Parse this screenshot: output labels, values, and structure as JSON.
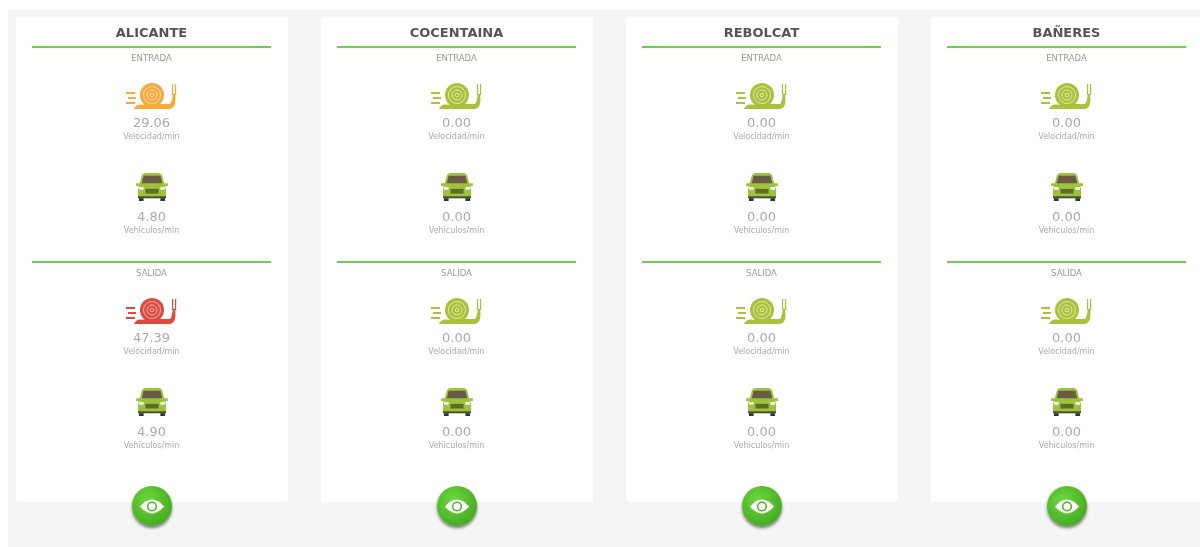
{
  "stations": [
    {
      "name": "ALICANTE",
      "sections": [
        {
          "label": "ENTRADA",
          "speed": {
            "value": "29.06",
            "unit": "Velocidad/min",
            "color": "#f9a93a"
          },
          "vehicles": {
            "value": "4.80",
            "unit": "Vehiculos/min"
          }
        },
        {
          "label": "SALIDA",
          "speed": {
            "value": "47.39",
            "unit": "Velocidad/min",
            "color": "#e0483d"
          },
          "vehicles": {
            "value": "4.90",
            "unit": "Vehiculos/min"
          }
        }
      ]
    },
    {
      "name": "COCENTAINA",
      "sections": [
        {
          "label": "ENTRADA",
          "speed": {
            "value": "0.00",
            "unit": "Velocidad/min",
            "color": "#a9c23a"
          },
          "vehicles": {
            "value": "0.00",
            "unit": "Vehiculos/min"
          }
        },
        {
          "label": "SALIDA",
          "speed": {
            "value": "0.00",
            "unit": "Velocidad/min",
            "color": "#a9c23a"
          },
          "vehicles": {
            "value": "0.00",
            "unit": "Vehiculos/min"
          }
        }
      ]
    },
    {
      "name": "REBOLCAT",
      "sections": [
        {
          "label": "ENTRADA",
          "speed": {
            "value": "0.00",
            "unit": "Velocidad/min",
            "color": "#a9c23a"
          },
          "vehicles": {
            "value": "0.00",
            "unit": "Vehiculos/min"
          }
        },
        {
          "label": "SALIDA",
          "speed": {
            "value": "0.00",
            "unit": "Velocidad/min",
            "color": "#a9c23a"
          },
          "vehicles": {
            "value": "0.00",
            "unit": "Vehiculos/min"
          }
        }
      ]
    },
    {
      "name": "BAÑERES",
      "sections": [
        {
          "label": "ENTRADA",
          "speed": {
            "value": "0.00",
            "unit": "Velocidad/min",
            "color": "#a9c23a"
          },
          "vehicles": {
            "value": "0.00",
            "unit": "Vehiculos/min"
          }
        },
        {
          "label": "SALIDA",
          "speed": {
            "value": "0.00",
            "unit": "Velocidad/min",
            "color": "#a9c23a"
          },
          "vehicles": {
            "value": "0.00",
            "unit": "Vehiculos/min"
          }
        }
      ]
    }
  ]
}
